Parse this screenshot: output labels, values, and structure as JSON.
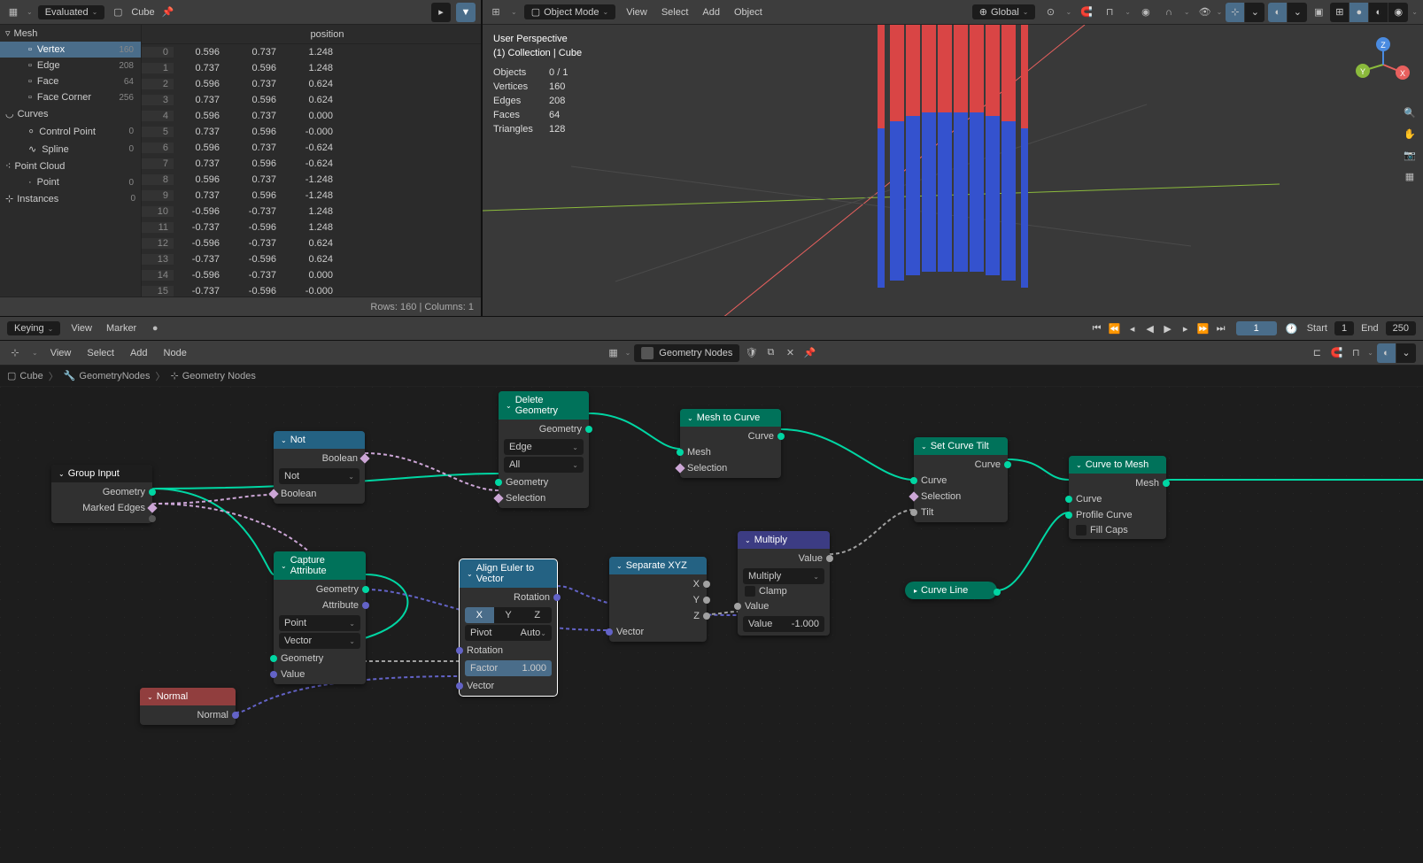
{
  "spreadsheet": {
    "mode": "Evaluated",
    "object": "Cube",
    "tree": {
      "mesh": "Mesh",
      "items": [
        {
          "name": "Vertex",
          "count": 160,
          "selected": true
        },
        {
          "name": "Edge",
          "count": 208
        },
        {
          "name": "Face",
          "count": 64
        },
        {
          "name": "Face Corner",
          "count": 256
        }
      ],
      "curves": "Curves",
      "curve_items": [
        {
          "name": "Control Point",
          "count": 0
        },
        {
          "name": "Spline",
          "count": 0
        }
      ],
      "pointcloud": "Point Cloud",
      "pc_items": [
        {
          "name": "Point",
          "count": 0
        }
      ],
      "instances": "Instances",
      "inst_count": 0
    },
    "column": "position",
    "rows": [
      [
        0,
        "0.596",
        "0.737",
        "1.248"
      ],
      [
        1,
        "0.737",
        "0.596",
        "1.248"
      ],
      [
        2,
        "0.596",
        "0.737",
        "0.624"
      ],
      [
        3,
        "0.737",
        "0.596",
        "0.624"
      ],
      [
        4,
        "0.596",
        "0.737",
        "0.000"
      ],
      [
        5,
        "0.737",
        "0.596",
        "-0.000"
      ],
      [
        6,
        "0.596",
        "0.737",
        "-0.624"
      ],
      [
        7,
        "0.737",
        "0.596",
        "-0.624"
      ],
      [
        8,
        "0.596",
        "0.737",
        "-1.248"
      ],
      [
        9,
        "0.737",
        "0.596",
        "-1.248"
      ],
      [
        10,
        "-0.596",
        "-0.737",
        "1.248"
      ],
      [
        11,
        "-0.737",
        "-0.596",
        "1.248"
      ],
      [
        12,
        "-0.596",
        "-0.737",
        "0.624"
      ],
      [
        13,
        "-0.737",
        "-0.596",
        "0.624"
      ],
      [
        14,
        "-0.596",
        "-0.737",
        "0.000"
      ],
      [
        15,
        "-0.737",
        "-0.596",
        "-0.000"
      ]
    ],
    "footer": "Rows: 160   |   Columns: 1"
  },
  "viewport": {
    "mode": "Object Mode",
    "menus": [
      "View",
      "Select",
      "Add",
      "Object"
    ],
    "orientation": "Global",
    "overlay": {
      "perspective": "User Perspective",
      "collection": "(1) Collection | Cube",
      "stats": [
        [
          "Objects",
          "0 / 1"
        ],
        [
          "Vertices",
          "160"
        ],
        [
          "Edges",
          "208"
        ],
        [
          "Faces",
          "64"
        ],
        [
          "Triangles",
          "128"
        ]
      ]
    }
  },
  "timeline": {
    "menus": [
      "Keying",
      "View",
      "Marker"
    ],
    "current": 1,
    "start_label": "Start",
    "start": 1,
    "end_label": "End",
    "end": 250
  },
  "node_editor": {
    "menus": [
      "View",
      "Select",
      "Add",
      "Node"
    ],
    "tree_name": "Geometry Nodes",
    "breadcrumb": [
      "Cube",
      "GeometryNodes",
      "Geometry Nodes"
    ],
    "nodes": {
      "group_input": {
        "title": "Group Input",
        "out": [
          "Geometry",
          "Marked Edges"
        ]
      },
      "not": {
        "title": "Not",
        "out": [
          "Boolean"
        ],
        "op": "Not",
        "in": [
          "Boolean"
        ]
      },
      "capture": {
        "title": "Capture Attribute",
        "out": [
          "Geometry",
          "Attribute"
        ],
        "domain": "Point",
        "type": "Vector",
        "in": [
          "Geometry",
          "Value"
        ]
      },
      "normal": {
        "title": "Normal",
        "out": [
          "Normal"
        ]
      },
      "delete": {
        "title": "Delete Geometry",
        "out": [
          "Geometry"
        ],
        "domain": "Edge",
        "mode": "All",
        "in": [
          "Geometry",
          "Selection"
        ]
      },
      "align": {
        "title": "Align Euler to Vector",
        "out": [
          "Rotation"
        ],
        "axis": "X",
        "pivot": "Auto",
        "in": [
          "Rotation",
          "Factor",
          "Vector"
        ],
        "factor": "1.000"
      },
      "mesh_to_curve": {
        "title": "Mesh to Curve",
        "out": [
          "Curve"
        ],
        "in": [
          "Mesh",
          "Selection"
        ]
      },
      "separate": {
        "title": "Separate XYZ",
        "out": [
          "X",
          "Y",
          "Z"
        ],
        "in": [
          "Vector"
        ]
      },
      "multiply": {
        "title": "Multiply",
        "out": [
          "Value"
        ],
        "op": "Multiply",
        "clamp": "Clamp",
        "in": [
          "Value",
          "Value"
        ],
        "val": "-1.000"
      },
      "set_tilt": {
        "title": "Set Curve Tilt",
        "out": [
          "Curve"
        ],
        "in": [
          "Curve",
          "Selection",
          "Tilt"
        ]
      },
      "curve_line": {
        "title": "Curve Line"
      },
      "curve_to_mesh": {
        "title": "Curve to Mesh",
        "out": [
          "Mesh"
        ],
        "in": [
          "Curve",
          "Profile Curve",
          "Fill Caps"
        ]
      }
    }
  }
}
